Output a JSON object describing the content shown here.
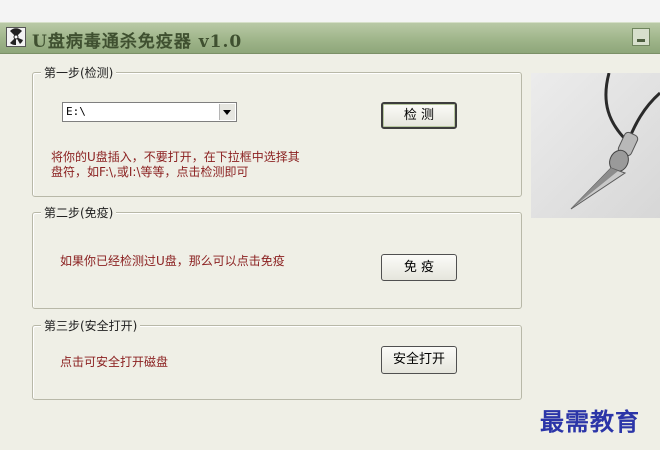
{
  "window": {
    "title": "U盘病毒通杀免疫器 v1.0"
  },
  "step1": {
    "group_title": "第一步(检测)",
    "drive_value": "E:\\",
    "detect_label": "检 测",
    "instructions_line1": "将你的U盘插入，不要打开，在下拉框中选择其",
    "instructions_line2": "盘符，如F:\\,或I:\\等等，点击检测即可"
  },
  "step2": {
    "group_title": "第二步(免疫)",
    "description": "如果你已经检测过U盘，那么可以点击免疫",
    "immunize_label": "免 疫"
  },
  "step3": {
    "group_title": "第三步(安全打开)",
    "description": "点击可安全打开磁盘",
    "safe_open_label": "安全打开"
  },
  "watermark": "最需教育",
  "icons": [
    "app-icon",
    "minimize-icon",
    "dropdown-arrow-icon"
  ]
}
